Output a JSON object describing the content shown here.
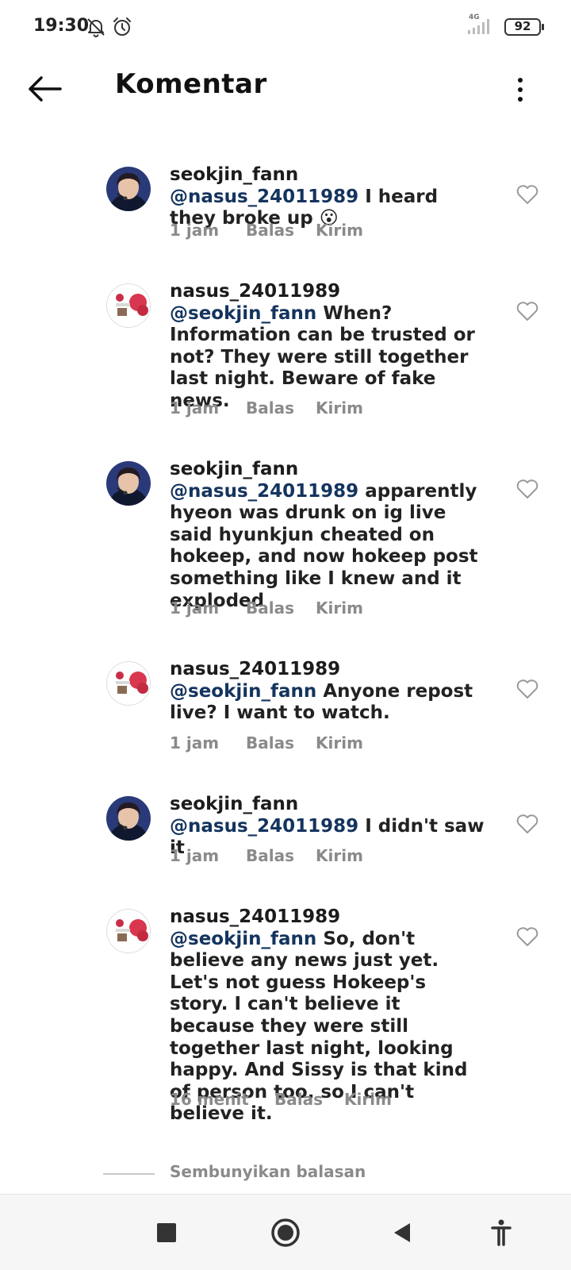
{
  "status_bar": {
    "time": "19:30",
    "network": "4G",
    "battery": "92",
    "icons": [
      "bell-off-icon",
      "alarm-icon",
      "signal-icon",
      "battery-icon"
    ]
  },
  "header": {
    "title": "Komentar",
    "back_icon": "arrow-left-icon",
    "menu_icon": "more-vertical-icon"
  },
  "comments": [
    {
      "username": "seokjin_fann",
      "mention": "@nasus_24011989",
      "text": "I heard they broke up 😮",
      "time": "1 jam",
      "reply": "Balas",
      "send": "Kirim"
    },
    {
      "username": "nasus_24011989",
      "mention": "@seokjin_fann",
      "text": "When? Information can be trusted or not?  They were still together last night.  Beware of fake news.",
      "time": "1 jam",
      "reply": "Balas",
      "send": "Kirim"
    },
    {
      "username": "seokjin_fann",
      "mention": "@nasus_24011989",
      "text": "apparently hyeon was drunk on ig live said hyunkjun cheated on hokeep, and now hokeep post something like I knew and it exploded",
      "time": "1 jam",
      "reply": "Balas",
      "send": "Kirim"
    },
    {
      "username": "nasus_24011989",
      "mention": "@seokjin_fann",
      "text": "Anyone repost live?  I want to watch.",
      "time": "1 jam",
      "reply": "Balas",
      "send": "Kirim"
    },
    {
      "username": "seokjin_fann",
      "mention": "@nasus_24011989",
      "text": "I didn't saw it",
      "time": "1 jam",
      "reply": "Balas",
      "send": "Kirim"
    },
    {
      "username": "nasus_24011989",
      "mention": "@seokjin_fann",
      "text": "So, don't believe any news just yet.  Let's not guess Hokeep's story.  I can't believe it because they were still together last night, looking happy.  And Sissy is that kind of person too, so I can't believe it.",
      "time": "16 menit",
      "reply": "Balas",
      "send": "Kirim"
    }
  ],
  "hide_replies": "Sembunyikan balasan",
  "nav_bar": {
    "icons": [
      "square-icon",
      "home-circle-icon",
      "back-triangle-icon",
      "accessibility-icon"
    ]
  },
  "colors": {
    "mention": "#14345e",
    "meta": "#8a8a8a",
    "text": "#1c1c1c"
  }
}
